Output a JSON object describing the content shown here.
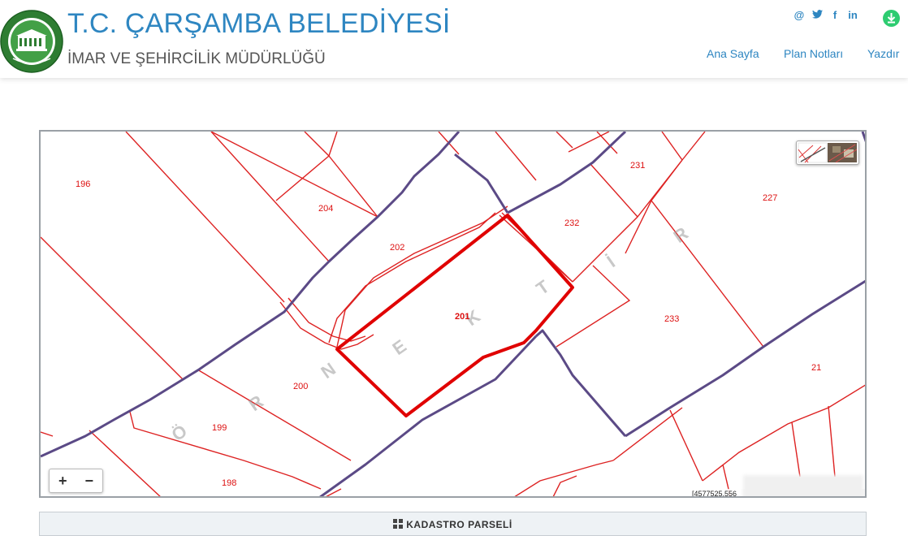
{
  "header": {
    "title": "T.C. ÇARŞAMBA BELEDİYESİ",
    "subtitle": "İMAR VE ŞEHİRCİLİK MÜDÜRLÜĞÜ",
    "logo_text": "ÇARŞAMBA BELEDİYESİ",
    "brand_color": "#2e86c1",
    "social_icons": [
      {
        "name": "email-icon",
        "glyph": "@"
      },
      {
        "name": "twitter-icon",
        "glyph": "t"
      },
      {
        "name": "facebook-icon",
        "glyph": "f"
      },
      {
        "name": "linkedin-icon",
        "glyph": "in"
      }
    ],
    "download_icon": "download-icon"
  },
  "nav": {
    "home": "Ana Sayfa",
    "plan_notes": "Plan Notları",
    "print": "Yazdır"
  },
  "map": {
    "parcel_labels": [
      "196",
      "204",
      "231",
      "227",
      "202",
      "232",
      "201",
      "233",
      "200",
      "199",
      "21",
      "198"
    ],
    "watermark": "ÖRNEKTİR",
    "watermark_letters": [
      "Ö",
      "R",
      "N",
      "E",
      "K",
      "T",
      "İ",
      "R"
    ],
    "coordinates": "[4577525.556",
    "zoom_in": "+",
    "zoom_out": "−",
    "layer_switch_icon": "layer-thumbnail-icon",
    "parcel_color": "#dd2222",
    "boundary_color": "#5b4a86",
    "selected_color": "#e00000"
  },
  "panel": {
    "title": "KADASTRO PARSELİ",
    "icon": "grid-icon"
  }
}
